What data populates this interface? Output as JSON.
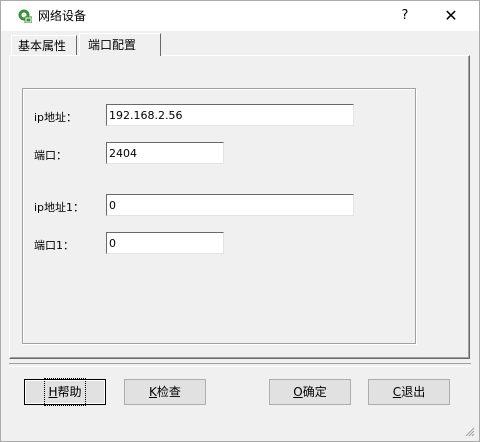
{
  "window": {
    "title": "网络设备",
    "help_label": "?",
    "close_label": "✕"
  },
  "tabs": [
    {
      "label": "基本属性",
      "active": false
    },
    {
      "label": "端口配置",
      "active": true
    }
  ],
  "form": {
    "ip1_label": "ip地址：",
    "ip1_value": "192.168.2.56",
    "port1_label": "端口：",
    "port1_value": "2404",
    "ip2_label": "ip地址1：",
    "ip2_value": "0",
    "port2_label": "端口1：",
    "port2_value": "0"
  },
  "buttons": {
    "help": {
      "mnemonic": "H",
      "text": "帮助"
    },
    "check": {
      "mnemonic": "K",
      "text": "检查"
    },
    "ok": {
      "mnemonic": "O",
      "text": "确定"
    },
    "exit": {
      "mnemonic": "C",
      "text": "退出"
    }
  },
  "colors": {
    "icon_green": "#3a8f3a",
    "dialog_bg": "#f0f0f0"
  }
}
